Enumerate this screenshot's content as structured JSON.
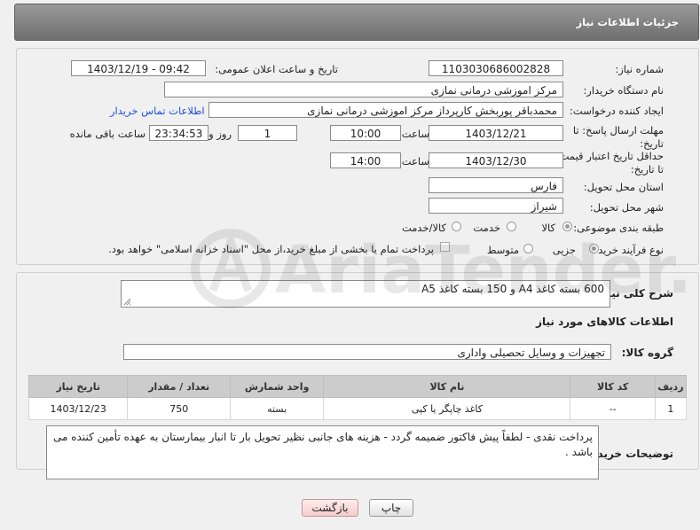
{
  "header": {
    "title": "جزئیات اطلاعات نیاز"
  },
  "labels": {
    "need_number": "شماره نیاز:",
    "announce_datetime": "تاریخ و ساعت اعلان عمومی:",
    "buyer_org": "نام دستگاه خریدار:",
    "requester": "ایجاد کننده درخواست:",
    "contact_link": "اطلاعات تماس خریدار",
    "reply_deadline": "مهلت ارسال پاسخ: تا تاریخ:",
    "time": "ساعت",
    "day_and": "روز و",
    "remaining": "ساعت باقی مانده",
    "price_validity": "حداقل تاریخ اعتبار قیمت: تا تاریخ:",
    "province": "استان محل تحویل:",
    "city": "شهر محل تحویل:",
    "category": "طبقه بندی موضوعی:",
    "process_type": "نوع فرآیند خرید :",
    "payment_note": "پرداخت تمام یا بخشی از مبلغ خرید،از محل \"اسناد خزانه اسلامی\" خواهد بود.",
    "general_desc": "شرح کلی نیاز:",
    "goods_info": "اطلاعات کالاهای مورد نیاز",
    "goods_group": "گروه کالا:",
    "buyer_notes": "توضیحات خریدار:"
  },
  "values": {
    "need_number": "1103030686002828",
    "announce_datetime": "1403/12/19 - 09:42",
    "buyer_org": "مرکز اموزشی درمانی نمازی",
    "requester": "محمدباقر پوربخش کارپرداز مرکز اموزشی درمانی نمازی",
    "reply_date": "1403/12/21",
    "reply_time": "10:00",
    "days": "1",
    "remaining_time": "23:34:53",
    "validity_date": "1403/12/30",
    "validity_time": "14:00",
    "province": "فارس",
    "city": "شیراز",
    "general_desc": "600  بسته کاغذ A4 و 150 بسته کاغذ A5",
    "goods_group": "تجهیزات و وسایل تحصیلی واداری",
    "buyer_notes": "پرداخت نقدی - لطفاً پیش فاکتور ضمیمه گردد - هزینه های جانبی نظیر تحویل بار تا انبار بیمارستان به عهده تأمین کننده می باشد ."
  },
  "category_options": {
    "goods": "کالا",
    "service": "خدمت",
    "goods_service": "کالا/خدمت"
  },
  "process_options": {
    "partial": "جزیی",
    "medium": "متوسط"
  },
  "table": {
    "headers": [
      "ردیف",
      "کد کالا",
      "نام کالا",
      "واحد شمارش",
      "تعداد / مقدار",
      "تاریخ نیاز"
    ],
    "rows": [
      [
        "1",
        "--",
        "کاغذ چاپگر یا کپی",
        "بسته",
        "750",
        "1403/12/23"
      ]
    ]
  },
  "buttons": {
    "print": "چاپ",
    "back": "بازگشت"
  },
  "watermark": {
    "text": "AriaTender.neT"
  }
}
